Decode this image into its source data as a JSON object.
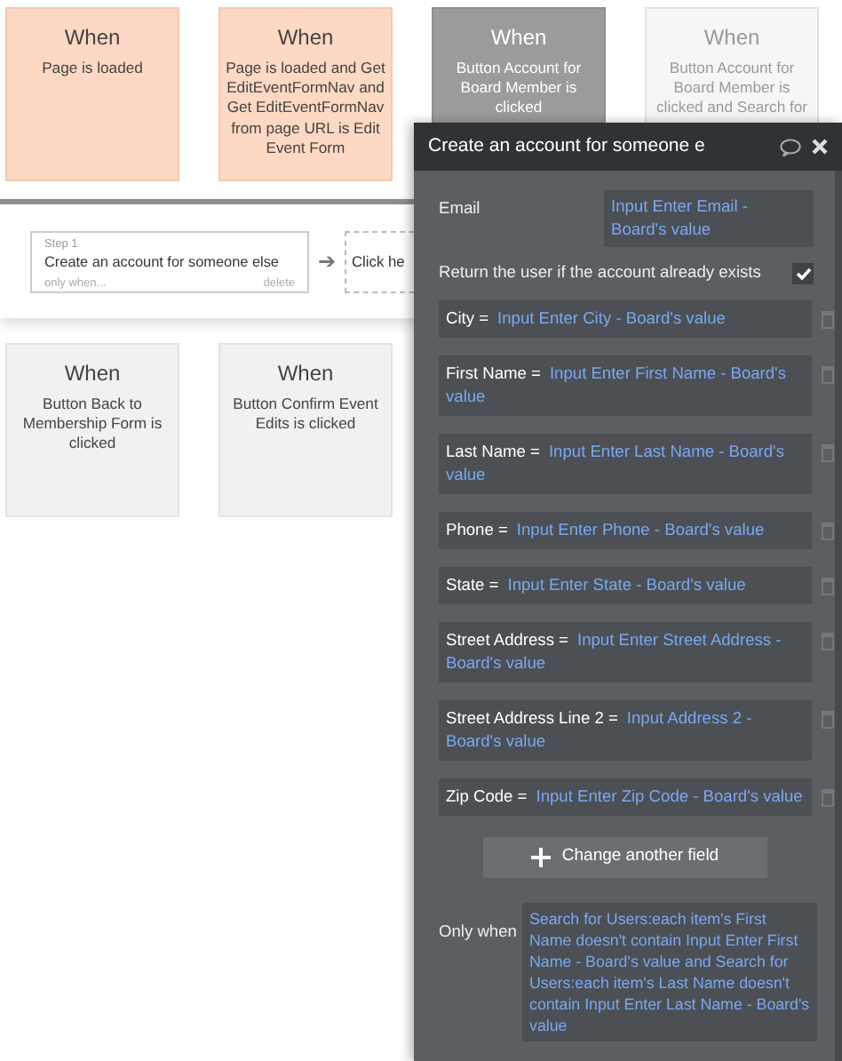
{
  "events_top": [
    {
      "heading": "When",
      "condition": "Page is loaded",
      "kind": "page",
      "selected": false,
      "faded": false
    },
    {
      "heading": "When",
      "condition": "Page is loaded and Get EditEventFormNav and Get EditEventFormNav from page URL is Edit Event Form",
      "kind": "page",
      "selected": false,
      "faded": false
    },
    {
      "heading": "When",
      "condition": "Button Account for Board Member is clicked",
      "kind": "element",
      "selected": true,
      "faded": false
    },
    {
      "heading": "When",
      "condition": "Button Account for Board Member is clicked and Search for",
      "kind": "element",
      "selected": false,
      "faded": true
    }
  ],
  "workflow": {
    "steps": [
      {
        "step_label": "Step 1",
        "title": "Create an account for someone else",
        "only_when": "only when...",
        "delete": "delete"
      }
    ],
    "arrow": "➔",
    "add_step": "Click he"
  },
  "events_bottom": [
    {
      "heading": "When",
      "condition": "Button Back to Membership Form is clicked",
      "kind": "element",
      "selected": false,
      "faded": false
    },
    {
      "heading": "When",
      "condition": "Button Confirm Event Edits is clicked",
      "kind": "element",
      "selected": false,
      "faded": false
    }
  ],
  "panel": {
    "title": "Create an account for someone e",
    "email": {
      "label": "Email",
      "value": "Input Enter Email - Board's value"
    },
    "return_user": {
      "label": "Return the user if the account already exists",
      "checked": true
    },
    "fields": [
      {
        "label": "City =",
        "value": "Input Enter City - Board's value"
      },
      {
        "label": "First Name =",
        "value": "Input Enter First Name - Board's value"
      },
      {
        "label": "Last Name =",
        "value": "Input Enter Last Name - Board's value"
      },
      {
        "label": "Phone =",
        "value": "Input Enter Phone - Board's value"
      },
      {
        "label": "State =",
        "value": "Input Enter State - Board's value"
      },
      {
        "label": "Street Address =",
        "value": "Input Enter Street Address - Board's value"
      },
      {
        "label": "Street Address Line 2 =",
        "value": "Input Address 2 - Board's value"
      },
      {
        "label": "Zip Code =",
        "value": "Input Enter Zip Code - Board's value"
      }
    ],
    "change_button": "Change another field",
    "only_when": {
      "label": "Only when",
      "value": "Search for Users:each item's First Name doesn't contain Input Enter First Name - Board's value and Search for Users:each item's Last Name doesn't contain Input Enter Last Name - Board's value"
    }
  }
}
